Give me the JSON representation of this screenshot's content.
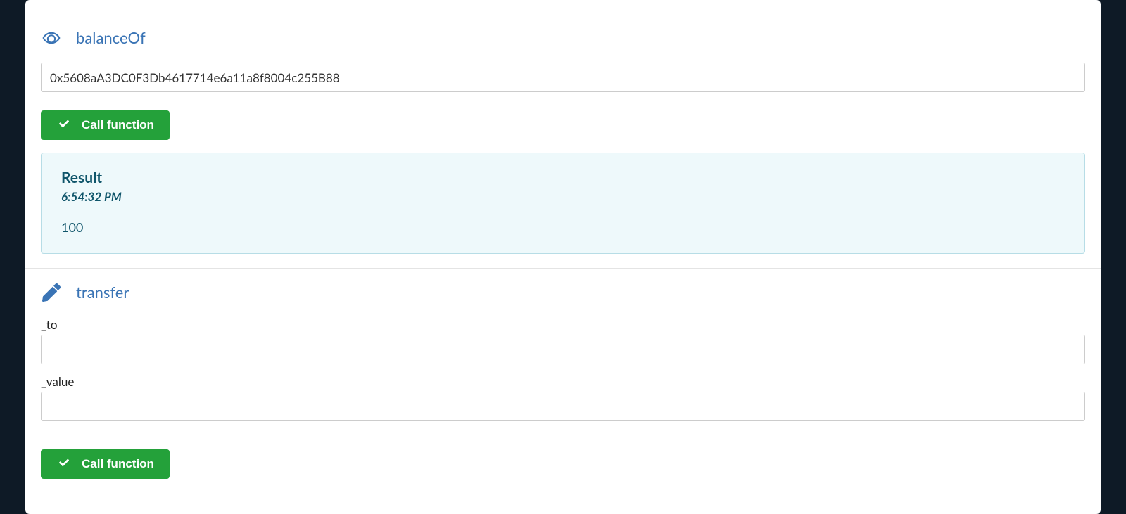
{
  "balanceOf": {
    "title": "balanceOf",
    "address_value": "0x5608aA3DC0F3Db4617714e6a11a8f8004c255B88",
    "call_button": "Call function",
    "result": {
      "heading": "Result",
      "timestamp": "6:54:32 PM",
      "value": "100"
    }
  },
  "transfer": {
    "title": "transfer",
    "to_label": "_to",
    "to_value": "",
    "value_label": "_value",
    "value_value": "",
    "call_button": "Call function"
  }
}
